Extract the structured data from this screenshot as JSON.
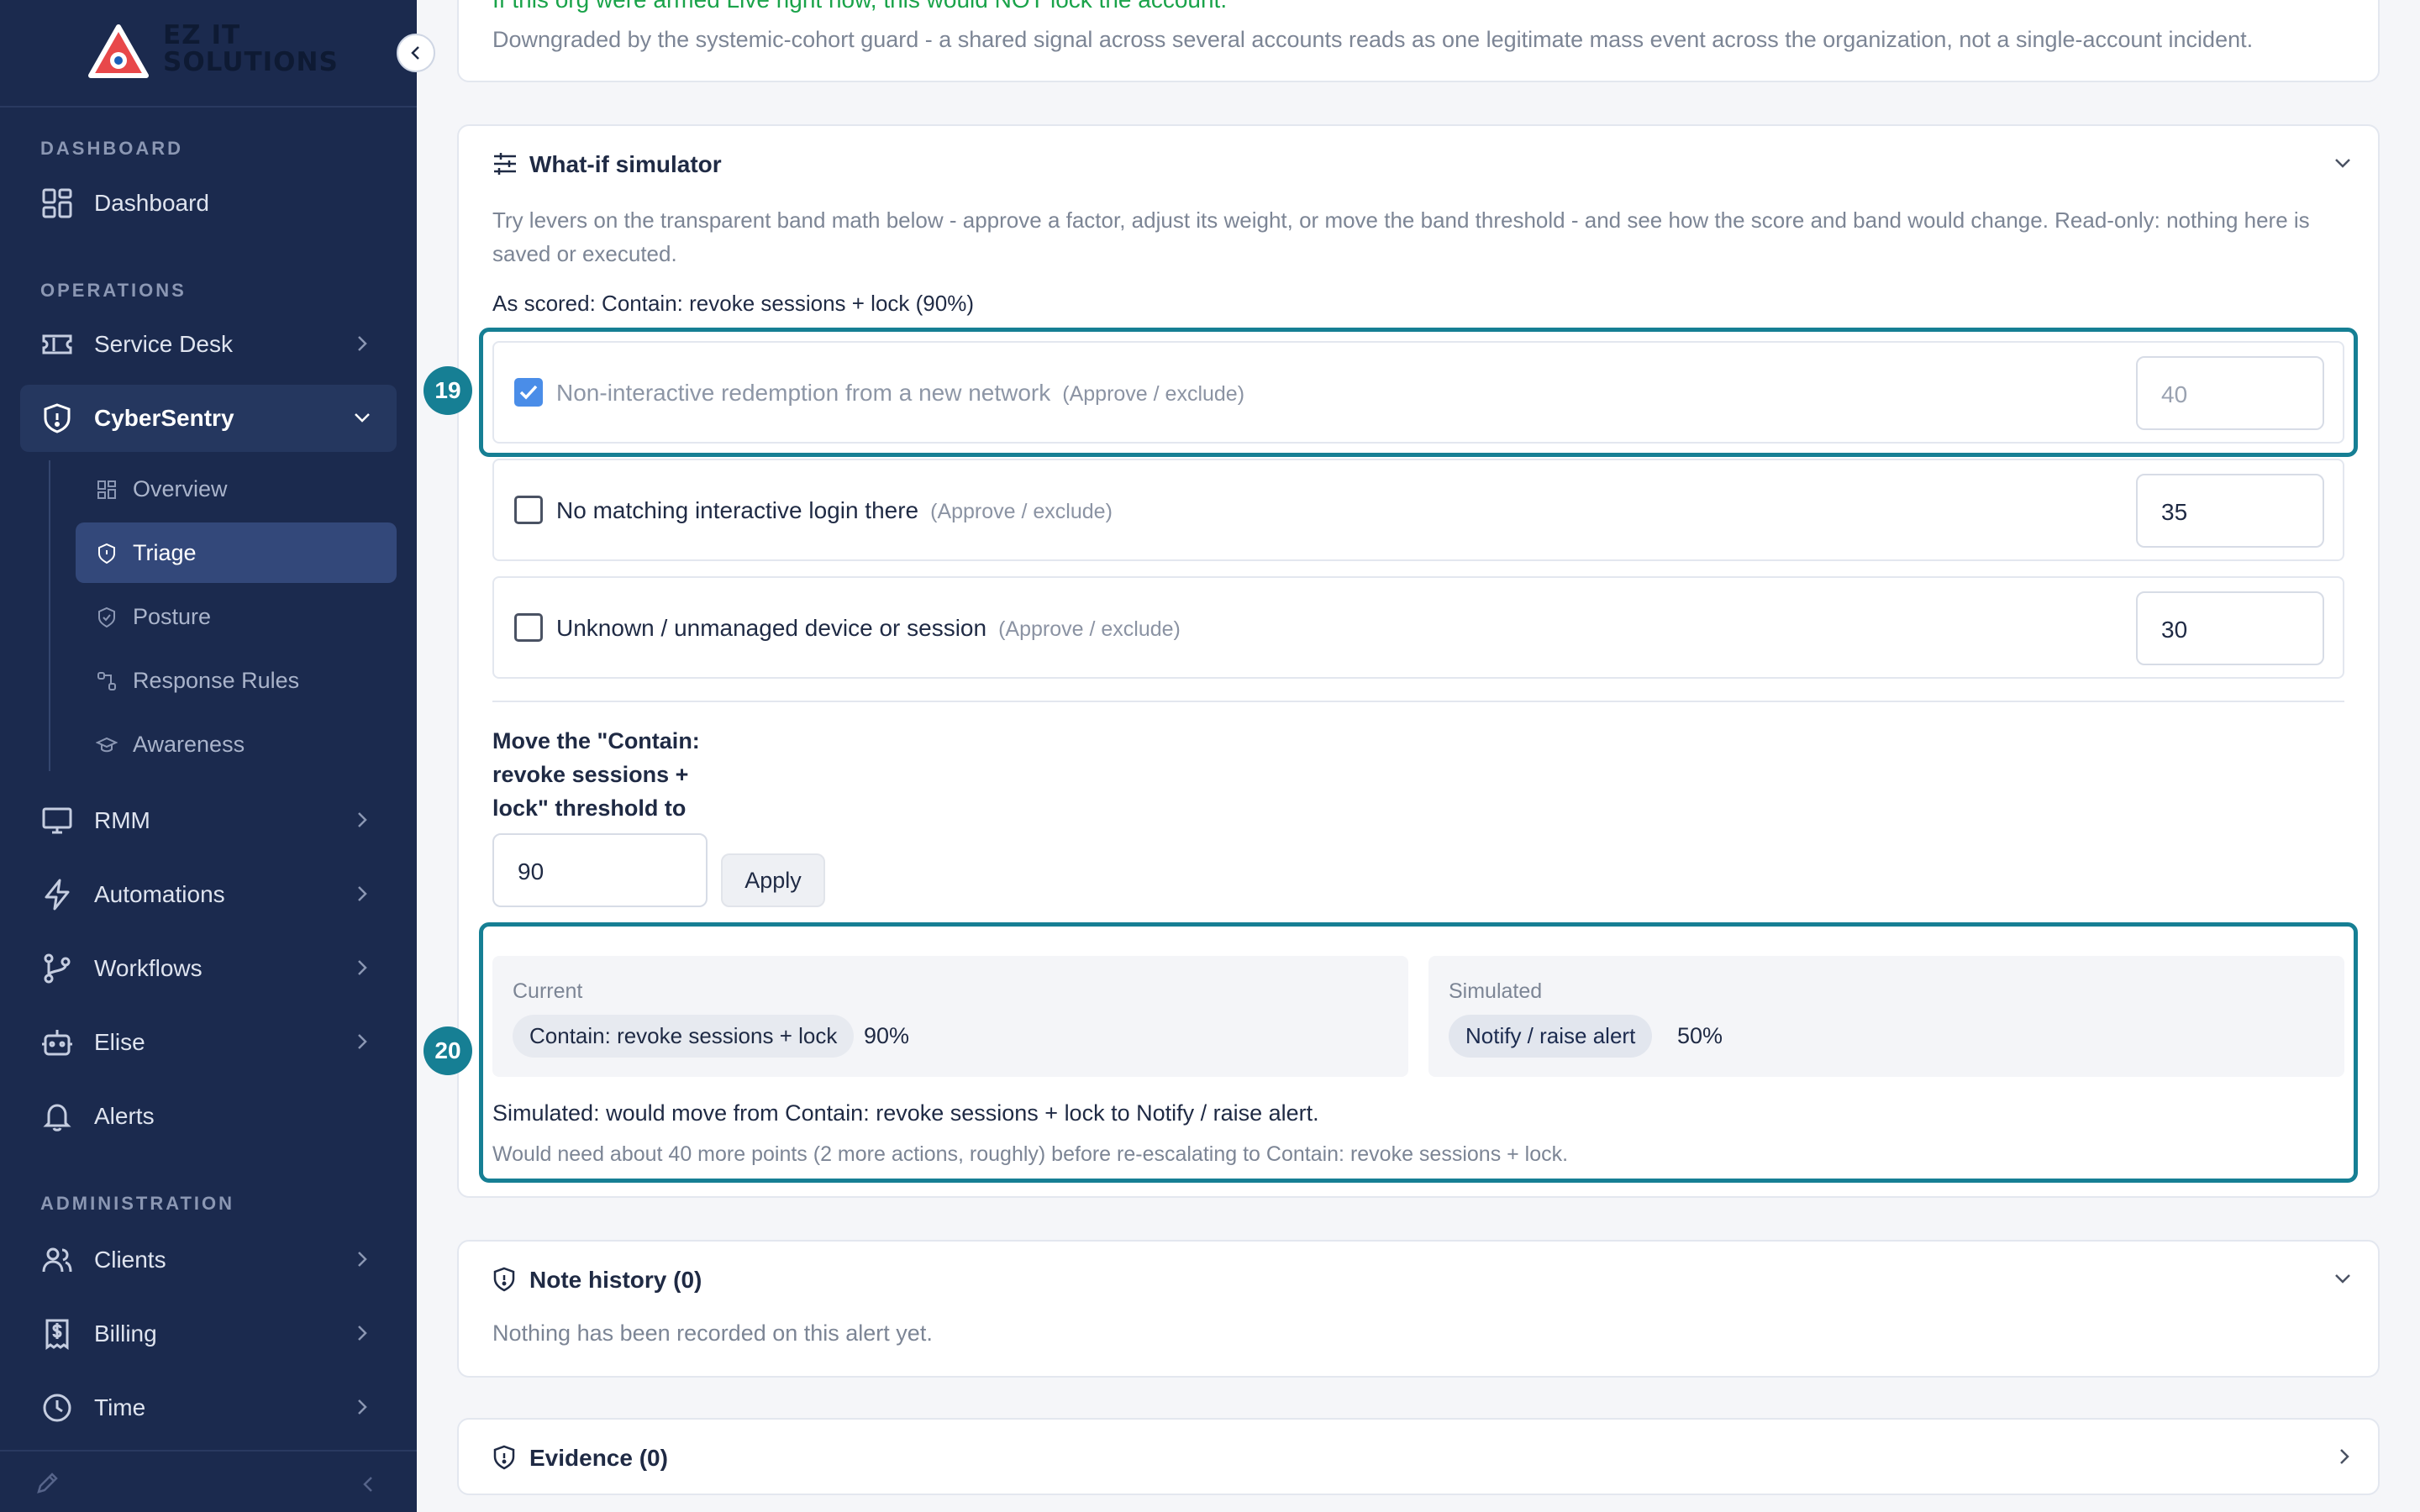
{
  "brand": {
    "name": "EZ IT\nSOLUTIONS"
  },
  "sidebar": {
    "sections": {
      "dashboard": "DASHBOARD",
      "operations": "OPERATIONS",
      "administration": "ADMINISTRATION"
    },
    "items": {
      "dashboard": "Dashboard",
      "service_desk": "Service Desk",
      "cybersentry": "CyberSentry",
      "rmm": "RMM",
      "automations": "Automations",
      "workflows": "Workflows",
      "elise": "Elise",
      "alerts": "Alerts",
      "clients": "Clients",
      "billing": "Billing",
      "time": "Time"
    },
    "cybersentry_sub": {
      "overview": "Overview",
      "triage": "Triage",
      "posture": "Posture",
      "response_rules": "Response Rules",
      "awareness": "Awareness"
    }
  },
  "top_card": {
    "warning": "If this org were armed Live right now, this would NOT lock the account.",
    "note": "Downgraded by the systemic-cohort guard - a shared signal across several accounts reads as one legitimate mass event across the organization, not a single-account incident."
  },
  "simulator": {
    "title": "What-if simulator",
    "intro": "Try levers on the transparent band math below - approve a factor, adjust its weight, or move the band threshold - and see how the score and band would change. Read-only: nothing here is saved or executed.",
    "as_scored": "As scored: Contain: revoke sessions + lock (90%)",
    "approve_hint": "(Approve / exclude)",
    "factors": [
      {
        "label": "Non-interactive redemption from a new network",
        "weight": "40",
        "checked": true
      },
      {
        "label": "No matching interactive login there",
        "weight": "35",
        "checked": false
      },
      {
        "label": "Unknown / unmanaged device or session",
        "weight": "30",
        "checked": false
      }
    ],
    "threshold_label": "Move the \"Contain: revoke sessions + lock\" threshold to",
    "threshold_value": "90",
    "apply_label": "Apply",
    "current_label": "Current",
    "current_band": "Contain: revoke sessions + lock",
    "current_pct": "90%",
    "simulated_label": "Simulated",
    "simulated_band": "Notify / raise alert",
    "simulated_pct": "50%",
    "result": "Simulated: would move from Contain: revoke sessions + lock to Notify / raise alert.",
    "result_note": "Would need about 40 more points (2 more actions, roughly) before re-escalating to Contain: revoke sessions + lock."
  },
  "annotations": {
    "factor_marker": "19",
    "result_marker": "20"
  },
  "notes": {
    "title": "Note history (0)",
    "empty": "Nothing has been recorded on this alert yet."
  },
  "evidence": {
    "title": "Evidence (0)"
  },
  "colors": {
    "sidebar_bg": "#1b2a4e",
    "accent": "#167f94",
    "warning_green": "#1aa34a",
    "checkbox_blue": "#4a8de8"
  }
}
